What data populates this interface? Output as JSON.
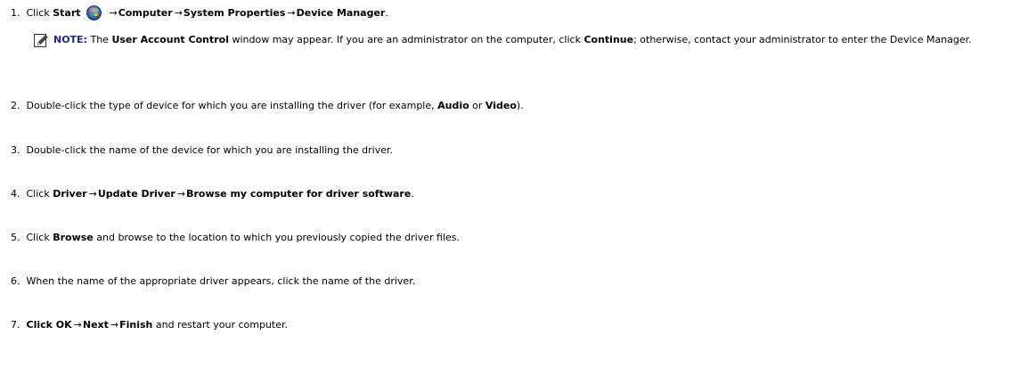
{
  "steps": {
    "s1": {
      "num": "1.",
      "click": "Click",
      "start": "Start",
      "arrow1": "→",
      "computer": "Computer",
      "arrow2": "→",
      "system_properties": "System Properties",
      "arrow3": "→",
      "device_manager": "Device Manager",
      "end": "."
    },
    "note": {
      "label": "NOTE:",
      "t1": " The ",
      "uac": "User Account Control",
      "t2": " window may appear. If you are an administrator on the computer, click ",
      "continue": "Continue",
      "t3": "; otherwise, contact your administrator to enter the Device Manager."
    },
    "s2": {
      "num": "2.",
      "t1": "Double-click the type of device for which you are installing the driver (for example, ",
      "audio": "Audio",
      "or": " or ",
      "video": "Video",
      "end": ")."
    },
    "s3": {
      "num": "3.",
      "text": "Double-click the name of the device for which you are installing the driver."
    },
    "s4": {
      "num": "4.",
      "click": "Click",
      "driver": "Driver",
      "arrow1": "→",
      "update_driver": "Update Driver",
      "arrow2": "→",
      "browse_my_computer": "Browse my computer for driver software",
      "end": "."
    },
    "s5": {
      "num": "5.",
      "click": "Click",
      "browse": "Browse",
      "rest": " and browse to the location to which you previously copied the driver files."
    },
    "s6": {
      "num": "6.",
      "text": "When the name of the appropriate driver appears, click the name of the driver."
    },
    "s7": {
      "num": "7.",
      "click_ok": "Click OK",
      "arrow1": "→",
      "next": "Next",
      "arrow2": "→",
      "finish": "Finish",
      "rest": " and restart your computer."
    }
  },
  "colors": {
    "note_label": "#1a2b8f",
    "text": "#000000"
  },
  "icons": {
    "start_button": "windows-start-orb-icon",
    "note": "pencil-note-icon"
  }
}
